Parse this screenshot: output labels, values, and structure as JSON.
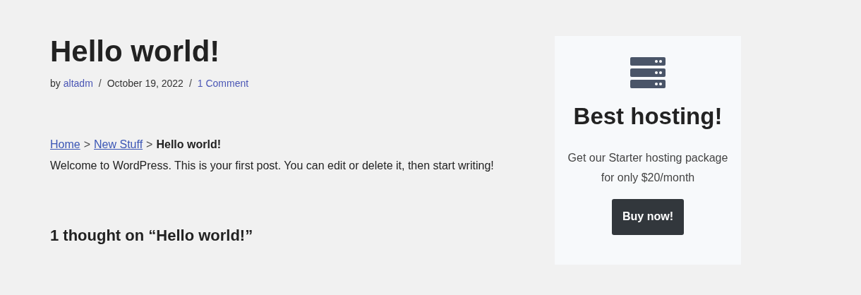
{
  "post": {
    "title": "Hello world!",
    "meta": [
      {
        "kind": "text",
        "text": "by"
      },
      {
        "kind": "link",
        "text": "altadm"
      },
      {
        "kind": "separator",
        "text": "/"
      },
      {
        "kind": "text",
        "text": "October 19, 2022"
      },
      {
        "kind": "separator",
        "text": "/"
      },
      {
        "kind": "link",
        "text": "1 Comment"
      }
    ],
    "breadcrumb": [
      {
        "kind": "link",
        "text": "Home"
      },
      {
        "kind": "separator",
        "text": ">"
      },
      {
        "kind": "link",
        "text": "New Stuff"
      },
      {
        "kind": "separator",
        "text": ">"
      },
      {
        "kind": "current",
        "text": "Hello world!"
      }
    ],
    "body": "Welcome to WordPress. This is your first post. You can edit or delete it, then start writing!",
    "comments_heading": "1 thought on “Hello world!”"
  },
  "sidebar": {
    "heading": "Best hosting!",
    "text": "Get our Starter hosting package for only $20/month",
    "button": "Buy now!"
  }
}
